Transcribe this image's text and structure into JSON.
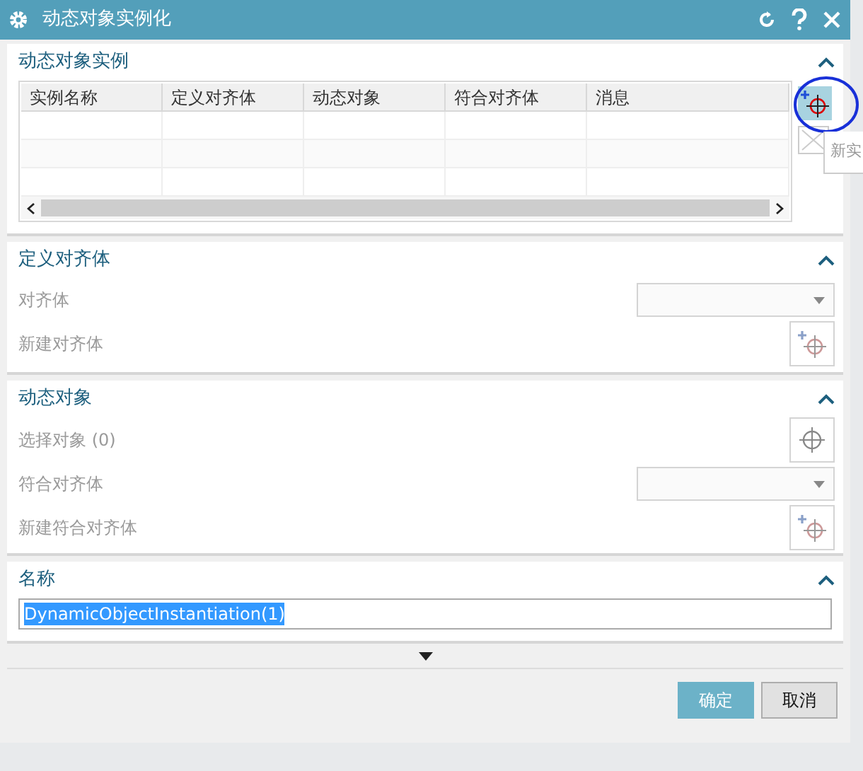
{
  "window": {
    "title": "动态对象实例化"
  },
  "instances": {
    "title": "动态对象实例",
    "expanded": true,
    "columns": [
      "实例名称",
      "定义对齐体",
      "动态对象",
      "符合对齐体",
      "消息"
    ],
    "tooltip": "新实"
  },
  "alignment": {
    "title": "定义对齐体",
    "expanded": true,
    "rows": [
      {
        "kind": "dropdown",
        "label": "对齐体"
      },
      {
        "kind": "create",
        "label": "新建对齐体"
      }
    ]
  },
  "dynamic_object": {
    "title": "动态对象",
    "expanded": true,
    "rows": [
      {
        "kind": "select",
        "label": "选择对象 (0)"
      },
      {
        "kind": "dropdown",
        "label": "符合对齐体"
      },
      {
        "kind": "create",
        "label": "新建符合对齐体"
      }
    ]
  },
  "name": {
    "title": "名称",
    "expanded": true,
    "value": "DynamicObjectInstantiation(1)"
  },
  "buttons": [
    {
      "label": "确定",
      "kind": "primary"
    },
    {
      "label": "取消",
      "kind": "secondary"
    }
  ]
}
